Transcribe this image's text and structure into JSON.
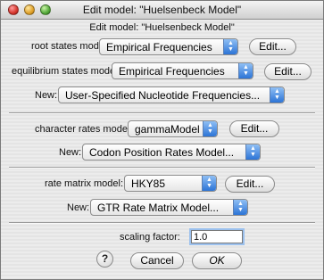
{
  "window": {
    "title": "Edit model: \"Huelsenbeck Model\""
  },
  "dialog": {
    "heading": "Edit model: \"Huelsenbeck Model\"",
    "root_states": {
      "label": "root states model:",
      "value": "Empirical Frequencies",
      "edit": "Edit..."
    },
    "equilibrium_states": {
      "label": "equilibrium states model:",
      "value": "Empirical Frequencies",
      "edit": "Edit..."
    },
    "new1": {
      "label": "New:",
      "value": "User-Specified Nucleotide Frequencies..."
    },
    "character_rates": {
      "label": "character rates model:",
      "value": "gammaModel",
      "edit": "Edit..."
    },
    "new2": {
      "label": "New:",
      "value": "Codon Position Rates Model..."
    },
    "rate_matrix": {
      "label": "rate matrix model:",
      "value": "HKY85",
      "edit": "Edit..."
    },
    "new3": {
      "label": "New:",
      "value": "GTR Rate Matrix Model..."
    },
    "scaling": {
      "label": "scaling factor:",
      "value": "1.0"
    },
    "help": "?",
    "cancel": "Cancel",
    "ok": "OK"
  },
  "colors": {
    "popup_arrow": "#2c74d6",
    "field_focus": "#9cc1ee"
  }
}
